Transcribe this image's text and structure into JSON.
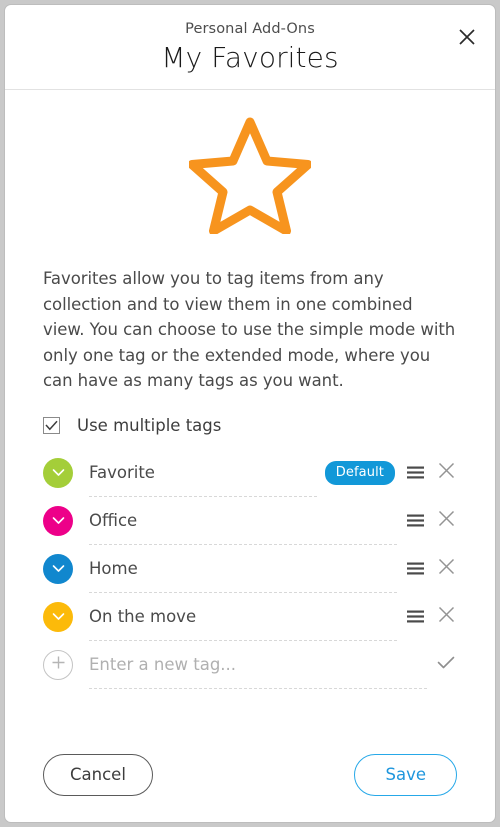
{
  "dialog": {
    "subtitle": "Personal Add-Ons",
    "title": "My Favorites",
    "close_icon": "close-icon"
  },
  "hero": {
    "icon": "star-outline-icon",
    "color": "#F7941E"
  },
  "description": "Favorites allow you to tag items from any collection and to view them in one combined view. You can choose to use the simple mode with only one tag or the extended mode, where you can have as many tags as you want.",
  "options": {
    "multiple_tags_label": "Use multiple tags",
    "multiple_tags_checked": true
  },
  "tags": [
    {
      "name": "Favorite",
      "color": "#A4CE39",
      "badge": "Default",
      "has_badge": true,
      "chevron_icon": "chevron-down-icon",
      "drag_icon": "drag-handle-icon",
      "delete_icon": "close-icon"
    },
    {
      "name": "Office",
      "color": "#ED0089",
      "badge": "",
      "has_badge": false,
      "chevron_icon": "chevron-down-icon",
      "drag_icon": "drag-handle-icon",
      "delete_icon": "close-icon"
    },
    {
      "name": "Home",
      "color": "#1187CE",
      "badge": "",
      "has_badge": false,
      "chevron_icon": "chevron-down-icon",
      "drag_icon": "drag-handle-icon",
      "delete_icon": "close-icon"
    },
    {
      "name": "On the move",
      "color": "#FCBA0A",
      "badge": "",
      "has_badge": false,
      "chevron_icon": "chevron-down-icon",
      "drag_icon": "drag-handle-icon",
      "delete_icon": "close-icon"
    }
  ],
  "new_tag": {
    "placeholder": "Enter a new tag...",
    "value": "",
    "add_icon": "plus-icon",
    "confirm_icon": "check-icon"
  },
  "footer": {
    "cancel_label": "Cancel",
    "save_label": "Save"
  },
  "colors": {
    "accent_blue": "#1298d8",
    "star_orange": "#F7941E"
  }
}
